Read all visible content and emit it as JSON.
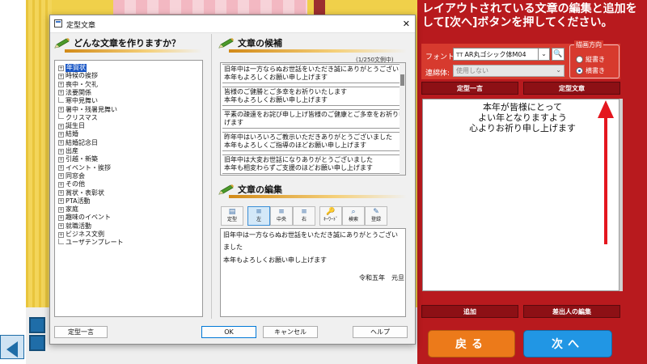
{
  "background_app": {
    "accent_yellow": "#f0d04a",
    "accent_blue": "#1f6da8"
  },
  "right_panel": {
    "instruction_line1": "レイアウトされている文章の編集と追加を",
    "instruction_line2": "して[次へ]ボタンを押してください。",
    "font_label": "フォント:",
    "font_value": "AR丸ゴシック体M04",
    "font_tt": "TT",
    "connection_label": "連綿体:",
    "connection_value": "使用しない",
    "direction_title": "描画方向",
    "direction_options": [
      {
        "label": "縦書き",
        "selected": false
      },
      {
        "label": "横書き",
        "selected": true
      }
    ],
    "tab_left": "定型一言",
    "tab_right": "定型文章",
    "preview_lines": [
      "本年が皆様にとって",
      "よい年となりますよう",
      "心よりお祈り申し上げます"
    ],
    "add_button": "追加",
    "sender_edit_button": "差出人の編集",
    "back_button": "戻る",
    "next_button": "次へ",
    "panel_color": "#b81a1e",
    "arrow_color": "#e4161e"
  },
  "dialog": {
    "title": "定型文章",
    "close_symbol": "✕",
    "left_heading": "どんな文章を作りますか？",
    "tree": [
      {
        "label": "年賀状",
        "toggle": "+",
        "selected": true
      },
      {
        "label": "時候の挨拶",
        "toggle": "+"
      },
      {
        "label": "喪中・欠礼",
        "toggle": "+"
      },
      {
        "label": "法要関係",
        "toggle": "+"
      },
      {
        "label": "寒中見舞い",
        "toggle": ""
      },
      {
        "label": "暑中・残暑見舞い",
        "toggle": "+"
      },
      {
        "label": "クリスマス",
        "toggle": ""
      },
      {
        "label": "誕生日",
        "toggle": "+"
      },
      {
        "label": "結婚",
        "toggle": "+"
      },
      {
        "label": "結婚記念日",
        "toggle": "+"
      },
      {
        "label": "出産",
        "toggle": "+"
      },
      {
        "label": "引越・新築",
        "toggle": "+"
      },
      {
        "label": "イベント・挨拶",
        "toggle": "+"
      },
      {
        "label": "同窓会",
        "toggle": "+"
      },
      {
        "label": "その他",
        "toggle": "+"
      },
      {
        "label": "賞状・表彰状",
        "toggle": "+"
      },
      {
        "label": "PTA活動",
        "toggle": "+"
      },
      {
        "label": "家庭",
        "toggle": "+"
      },
      {
        "label": "趣味のイベント",
        "toggle": "+"
      },
      {
        "label": "就職活動",
        "toggle": "+"
      },
      {
        "label": "ビジネス文例",
        "toggle": "+"
      },
      {
        "label": "ユーザテンプレート",
        "toggle": ""
      }
    ],
    "candidates_heading": "文章の候補",
    "candidates_count": "(1/250文例中)",
    "candidates": [
      {
        "line1": "旧年中は一方ならぬお世話をいただき誠にありがとうございました",
        "line2": "本年もよろしくお願い申し上げます"
      },
      {
        "line1": "皆様のご健勝とご多幸をお祈りいたします",
        "line2": "本年もよろしくお願い申し上げます"
      },
      {
        "line1": "平素の疎遠をお詫び申し上げ皆様のご健康とご多幸をお祈り申し上",
        "line2": "げます"
      },
      {
        "line1": "昨年中はいろいろご教示いただきありがとうございました",
        "line2": "本年もよろしくご指導のほどお願い申し上げます"
      },
      {
        "line1": "旧年中は大変お世話になりありがとうございました",
        "line2": "本年も相変わらずご支援のほどお願い申し上げます"
      }
    ],
    "edit_heading": "文章の編集",
    "tools": [
      {
        "label": "定型",
        "icon": "▤"
      },
      {
        "label": "左",
        "icon": "≡",
        "active": true
      },
      {
        "label": "中央",
        "icon": "≡"
      },
      {
        "label": "右",
        "icon": "≡"
      },
      {
        "label": "ｷｰﾜｰﾄﾞ",
        "icon": "🔑"
      },
      {
        "label": "検索",
        "icon": "⌕"
      },
      {
        "label": "登録",
        "icon": "✎"
      }
    ],
    "editor_lines": [
      "旧年中は一方ならぬお世話をいただき誠にありがとうござい",
      "ました",
      "本年もよろしくお願い申し上げます"
    ],
    "editor_signature": "令和五年　元旦",
    "btn_teikei_hitokoto": "定型一言",
    "btn_ok": "OK",
    "btn_cancel": "キャンセル",
    "btn_help": "ヘルプ"
  }
}
